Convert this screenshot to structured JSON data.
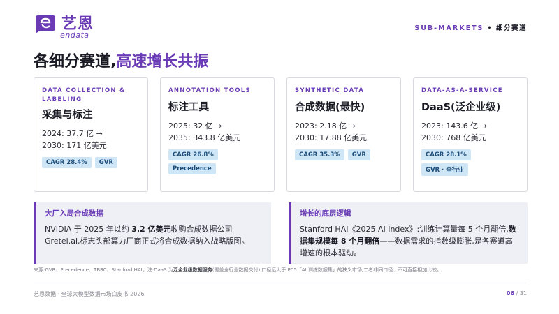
{
  "brand": {
    "name_cn": "艺恩",
    "name_en": "endata"
  },
  "section": {
    "en": "SUB-MARKETS",
    "separator": "•",
    "cn": "细分赛道"
  },
  "title": {
    "main": "各细分赛道,",
    "accent": "高速增长共振"
  },
  "cards": [
    {
      "tag": "DATA COLLECTION & LABELING",
      "name": "采集与标注",
      "stat1": "2024: 37.7 亿 →",
      "stat2": "2030: 171 亿美元",
      "badges": [
        "CAGR 28.4%",
        "GVR"
      ]
    },
    {
      "tag": "ANNOTATION TOOLS",
      "name": "标注工具",
      "stat1": "2025: 32 亿 →",
      "stat2": "2035: 343.8 亿美元",
      "badges": [
        "CAGR 26.8%",
        "Precedence"
      ]
    },
    {
      "tag": "SYNTHETIC DATA",
      "name": "合成数据(最快)",
      "stat1": "2023: 2.18 亿 →",
      "stat2": "2030: 17.88 亿美元",
      "badges": [
        "CAGR 35.3%",
        "GVR"
      ]
    },
    {
      "tag": "DATA-AS-A-SERVICE",
      "name": "DaaS(泛企业级)",
      "stat1": "2023: 143.6 亿 →",
      "stat2": "2030: 768 亿美元",
      "badges": [
        "CAGR 28.1%",
        "GVR · 全行业"
      ]
    }
  ],
  "panels": {
    "left": {
      "title": "大厂入局合成数据",
      "body_pre": "NVIDIA 于 2025 年以约 ",
      "body_bold": "3.2 亿美元",
      "body_post": "收购合成数据公司 Gretel.ai,标志头部算力厂商正式将合成数据纳入战略版图。"
    },
    "right": {
      "title": "增长的底层逻辑",
      "body_pre": "Stanford HAI《2025 AI Index》:训练计算量每 5 个月翻倍,",
      "body_bold": "数据集规模每 8 个月翻倍",
      "body_post": "——数据需求的指数级膨胀,是各赛道高增速的根本驱动。"
    }
  },
  "source": {
    "pre": "来源:GVR、Precedence、TBRC、Stanford HAI。注:DaaS 为",
    "bold": "泛企业级数据服务",
    "post": "(覆盖全行业数据交付),口径远大于 P05「AI 训练数据集」的狭义市场,二者非同口径、不可直接相加比较。"
  },
  "footer": {
    "left": "艺恩数据 · 全球大模型数据市场白皮书 2026",
    "page_current": "06",
    "page_sep": " / ",
    "page_total": "31"
  },
  "colors": {
    "accent": "#6a3bb5",
    "badge_bg": "#cfe6f7",
    "panel_bg": "#eef0f6"
  }
}
